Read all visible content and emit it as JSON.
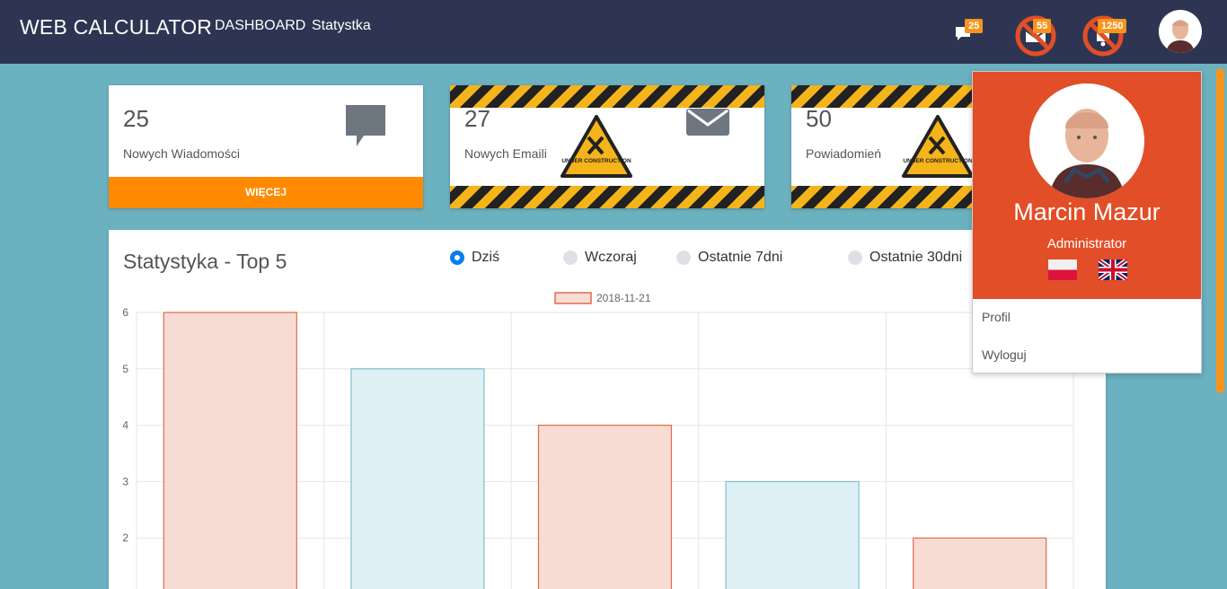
{
  "navbar": {
    "brand": "WEB CALCULATOR",
    "links": [
      "DASHBOARD",
      "Statystka"
    ],
    "messages_badge": "25",
    "emails_badge": "55",
    "notifications_badge": "1250"
  },
  "cards": [
    {
      "count": "25",
      "label": "Nowych Wiadomości",
      "more": "WIĘCEJ",
      "icon": "chat-bubble-icon"
    },
    {
      "count": "27",
      "label": "Nowych Emaili",
      "icon": "envelope-icon",
      "under_construction": "UNDER CONSTRUCTION"
    },
    {
      "count": "50",
      "label": "Powiadomień",
      "under_construction": "UNDER CONSTRUCTION"
    }
  ],
  "stats": {
    "title": "Statystyka - Top 5",
    "filters": [
      {
        "label": "Dziś",
        "selected": true
      },
      {
        "label": "Wczoraj",
        "selected": false
      },
      {
        "label": "Ostatnie 7dni",
        "selected": false
      },
      {
        "label": "Ostatnie 30dni",
        "selected": false
      }
    ]
  },
  "chart_data": {
    "type": "bar",
    "legend": [
      "2018-11-21"
    ],
    "values": [
      6,
      5,
      4,
      3,
      2
    ],
    "y_ticks": [
      6,
      5,
      4,
      3,
      2
    ],
    "colors": {
      "orange_fill": "#f7dcd3",
      "orange_stroke": "#e26a4a",
      "blue_fill": "#dff0f4",
      "blue_stroke": "#7fbfcc"
    }
  },
  "profile": {
    "name": "Marcin Mazur",
    "role": "Administrator",
    "links": [
      "Profil",
      "Wyloguj"
    ]
  },
  "colors": {
    "navbar": "#2d3552",
    "background": "#6bb1c0",
    "accent": "#ff8a00",
    "profile_header": "#e24e27"
  }
}
